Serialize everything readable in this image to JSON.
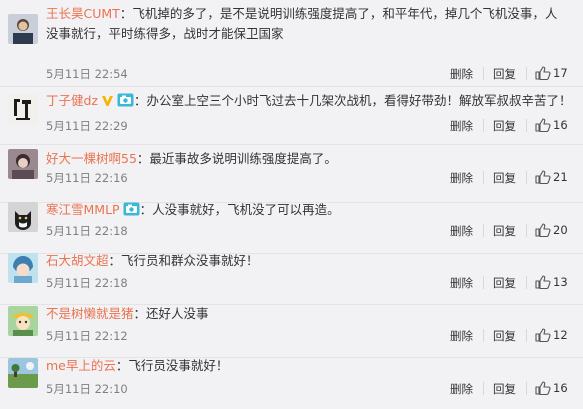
{
  "actions": {
    "delete": "删除",
    "reply": "回复"
  },
  "comments": [
    {
      "user": "王长昊CUMT",
      "text": "：飞机掉的多了，是不是说明训练强度提高了，和平年代，掉几个飞机没事，人没事就行，平时练得多，战时才能保卫国家",
      "time": "5月11日 22:54",
      "likes": "17",
      "avatar": "man-photo"
    },
    {
      "user": "丁子健dz",
      "text": "：办公室上空三个小时飞过去十几架次战机，看得好带劲！解放军叔叔辛苦了！",
      "time": "5月11日 22:29",
      "likes": "16",
      "avatar": "calligraphy"
    },
    {
      "user": "好大一棵树啊55",
      "text": "：最近事故多说明训练强度提高了。",
      "time": "5月11日 22:16",
      "likes": "21",
      "avatar": "portrait"
    },
    {
      "user": "寒江雪MMLP",
      "text": "：人没事就好，飞机没了可以再造。",
      "time": "5月11日 22:18",
      "likes": "20",
      "avatar": "cat"
    },
    {
      "user": "石大胡文超",
      "text": "：飞行员和群众没事就好！",
      "time": "5月11日 22:18",
      "likes": "13",
      "avatar": "anime"
    },
    {
      "user": "不是树懒就是猪",
      "text": "：还好人没事",
      "time": "5月11日 22:12",
      "likes": "12",
      "avatar": "cartoon"
    },
    {
      "user": "me早上的云",
      "text": "：飞行员没事就好！",
      "time": "5月11日 22:10",
      "likes": "16",
      "avatar": "landscape"
    }
  ],
  "colors": {
    "username": "#eb7350",
    "vip_badge": "#f5b400",
    "camera_badge": "#3ab8d9"
  },
  "icons": {
    "like": "thumbs-up-icon",
    "vip": "v-badge-icon",
    "camera": "camera-badge-icon"
  }
}
